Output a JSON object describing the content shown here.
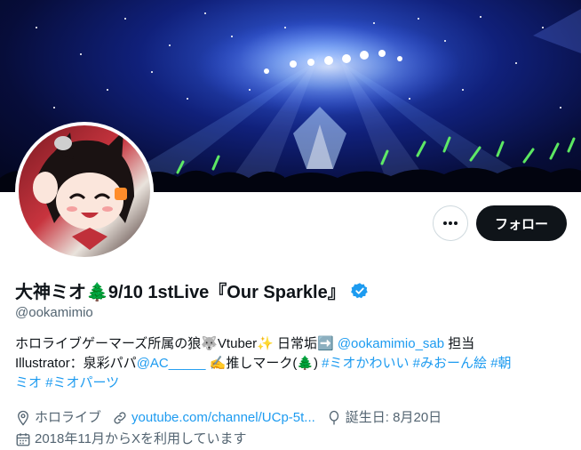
{
  "profile": {
    "display_name": "大神ミオ🌲9/10 1stLive『Our Sparkle』",
    "handle": "@ookamimio",
    "follow_label": "フォロー",
    "more_label": "•••"
  },
  "bio": {
    "line1_text": "ホロライブゲーマーズ所属の狼🐺Vtuber✨ 日常垢➡️ ",
    "line1_mention": "@ookamimio_sab",
    "line1_tail": " 担当",
    "line2_text": "Illustrator：泉彩パパ",
    "line2_mention": "@AC_____",
    "line2_mid": " ✍️推しマーク(🌲) ",
    "line2_tag1": "#ミオかわいい",
    "line2_tag2": "#みおーん絵",
    "line2_tag3_start": "#朝",
    "line3_tag3_end": "ミオ",
    "line3_tag4": "#ミオパーツ"
  },
  "meta": {
    "location": "ホロライブ",
    "website": "youtube.com/channel/UCp-5t...",
    "birthday": "誕生日: 8月20日",
    "joined": "2018年11月からXを利用しています"
  },
  "colors": {
    "accent": "#1d9bf0",
    "text_primary": "#0f1419",
    "text_secondary": "#536471",
    "follow_bg": "#0f1419",
    "verified": "#1d9bf0"
  },
  "icons": [
    "more-icon",
    "verified-icon",
    "location-icon",
    "link-icon",
    "birthday-icon",
    "calendar-icon"
  ]
}
